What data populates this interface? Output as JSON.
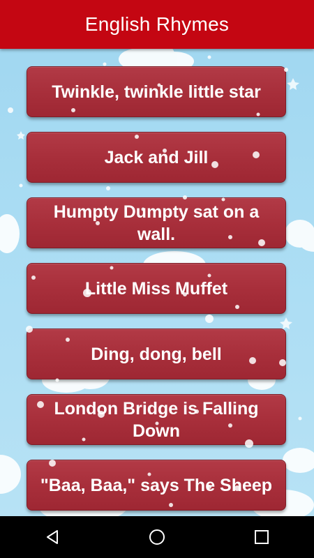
{
  "app_bar": {
    "title": "English Rhymes"
  },
  "colors": {
    "app_bar": "#c40612",
    "button": "#a82f3b",
    "sky": "#a9dcf3"
  },
  "rhymes": [
    "Twinkle, twinkle little star",
    "Jack and Jill",
    "Humpty Dumpty sat on a wall.",
    "Little Miss Muffet",
    "Ding, dong, bell",
    "London Bridge is Falling Down",
    "\"Baa, Baa,\" says The Sheep"
  ],
  "nav": {
    "icons": [
      "back-icon",
      "home-icon",
      "recents-icon"
    ]
  }
}
